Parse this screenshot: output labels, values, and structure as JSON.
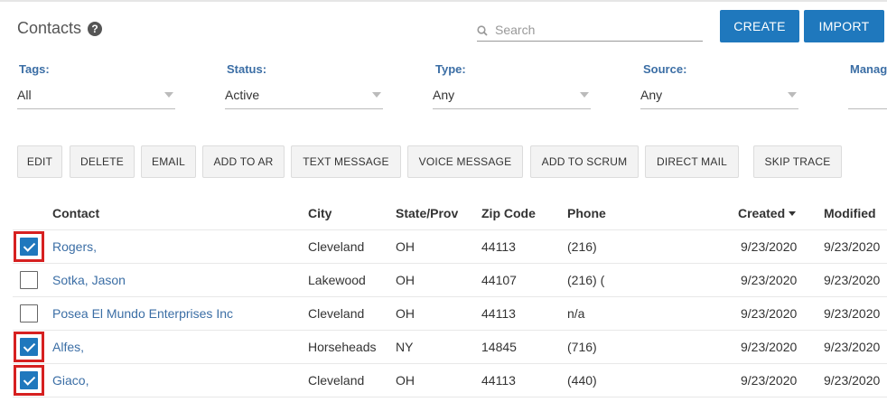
{
  "header": {
    "title": "Contacts",
    "help_icon": "question-circle-icon",
    "search_placeholder": "Search",
    "create_label": "CREATE",
    "import_label": "IMPORT"
  },
  "filters": [
    {
      "label": "Tags:",
      "value": "All"
    },
    {
      "label": "Status:",
      "value": "Active"
    },
    {
      "label": "Type:",
      "value": "Any"
    },
    {
      "label": "Source:",
      "value": "Any"
    },
    {
      "label": "Manag",
      "value": ""
    }
  ],
  "actions": [
    "EDIT",
    "DELETE",
    "EMAIL",
    "ADD TO AR",
    "TEXT MESSAGE",
    "VOICE MESSAGE",
    "ADD TO SCRUM",
    "DIRECT MAIL",
    "SKIP TRACE"
  ],
  "table": {
    "columns": [
      "Contact",
      "City",
      "State/Prov",
      "Zip Code",
      "Phone",
      "Created",
      "Modified"
    ],
    "rows": [
      {
        "checked": true,
        "contact": "Rogers,",
        "city": "Cleveland",
        "state": "OH",
        "zip": "44113",
        "phone": "(216)",
        "created": "9/23/2020",
        "modified": "9/23/2020"
      },
      {
        "checked": false,
        "contact": "Sotka, Jason",
        "city": "Lakewood",
        "state": "OH",
        "zip": "44107",
        "phone": "(216) (",
        "created": "9/23/2020",
        "modified": "9/23/2020"
      },
      {
        "checked": false,
        "contact": "Posea El Mundo Enterprises Inc",
        "city": "Cleveland",
        "state": "OH",
        "zip": "44113",
        "phone": "n/a",
        "created": "9/23/2020",
        "modified": "9/23/2020"
      },
      {
        "checked": true,
        "contact": "Alfes,",
        "city": "Horseheads",
        "state": "NY",
        "zip": "14845",
        "phone": "(716)",
        "created": "9/23/2020",
        "modified": "9/23/2020"
      },
      {
        "checked": true,
        "contact": "Giaco,",
        "city": "Cleveland",
        "state": "OH",
        "zip": "44113",
        "phone": "(440)",
        "created": "9/23/2020",
        "modified": "9/23/2020"
      }
    ]
  },
  "colors": {
    "primary": "#1f78bd",
    "link": "#3b6ea5",
    "highlight": "#d62020"
  }
}
